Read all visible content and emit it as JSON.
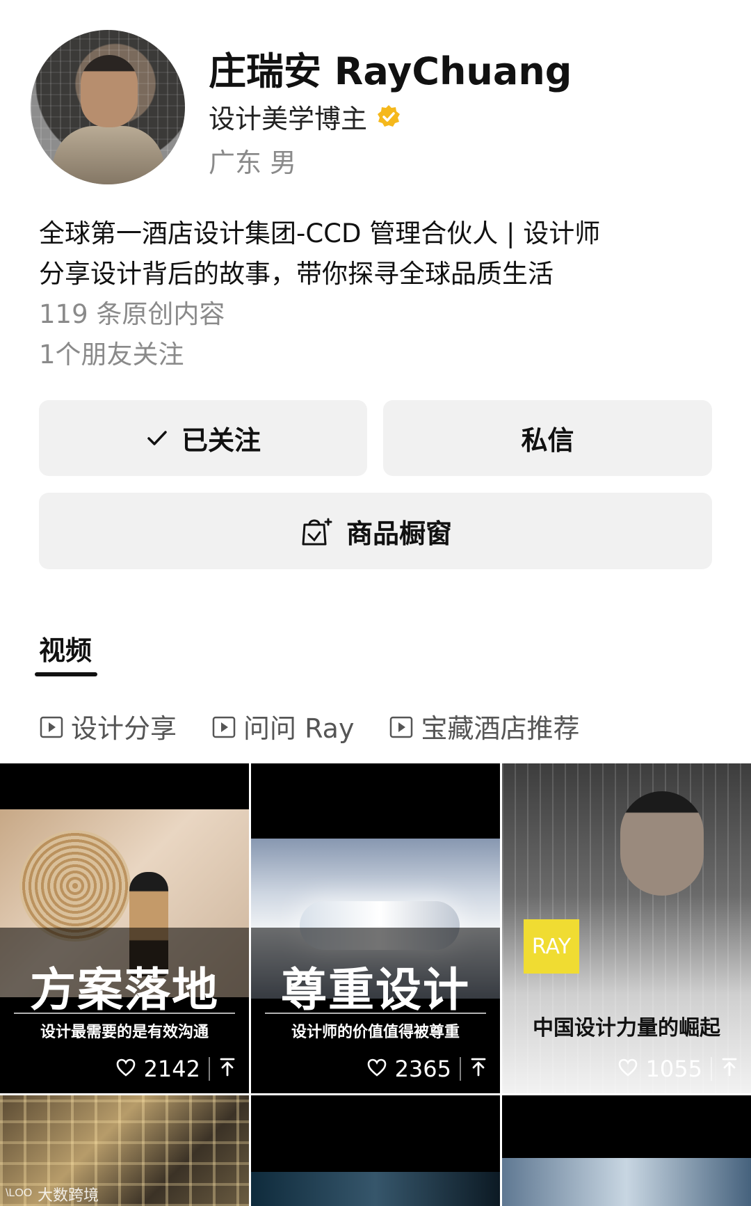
{
  "profile": {
    "name": "庄瑞安 RayChuang",
    "title": "设计美学博主",
    "location": "广东 男",
    "bio_line1": "全球第一酒店设计集团-CCD 管理合伙人 | 设计师",
    "bio_line2": "分享设计背后的故事，带你探寻全球品质生活",
    "original_count": "119 条原创内容",
    "friends_following": "1个朋友关注"
  },
  "actions": {
    "follow_label": "已关注",
    "message_label": "私信",
    "shop_label": "商品橱窗"
  },
  "tabs": {
    "video_label": "视频"
  },
  "collections": [
    {
      "label": "设计分享"
    },
    {
      "label": "问问 Ray"
    },
    {
      "label": "宝藏酒店推荐"
    }
  ],
  "videos": [
    {
      "title": "方案落地",
      "subtitle": "设计最需要的是有效沟通",
      "likes": "2142"
    },
    {
      "title": "尊重设计",
      "subtitle": "设计师的价值值得被尊重",
      "likes": "2365"
    },
    {
      "badge": "RAY",
      "title": "中国设计力量的崛起",
      "likes": "1055"
    }
  ],
  "watermark": "大数跨境",
  "colors": {
    "button_bg": "#f1f1f1",
    "verified": "#f5b81c",
    "muted_text": "#8a8a8a",
    "ray_badge": "#f0dc32"
  }
}
